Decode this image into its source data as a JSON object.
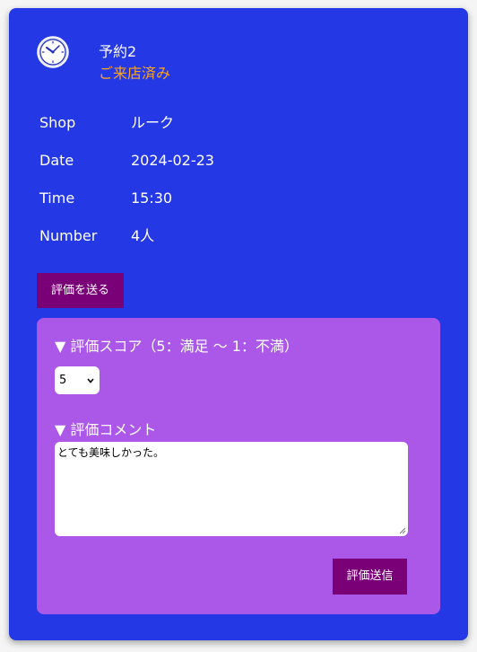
{
  "reservation": {
    "title": "予約2",
    "status": "ご来店済み",
    "status_color": "#ffa51f",
    "icon": "clock-icon"
  },
  "details": [
    {
      "label": "Shop",
      "value": "ルーク"
    },
    {
      "label": "Date",
      "value": "2024-02-23"
    },
    {
      "label": "Time",
      "value": "15:30"
    },
    {
      "label": "Number",
      "value": "4人"
    }
  ],
  "send_review_label": "評価を送る",
  "review": {
    "score_title": "▼ 評価スコア（5：満足 〜 1：不満）",
    "score_selected": "5",
    "comment_title": "▼ 評価コメント",
    "comment_value": "とても美味しかった。",
    "submit_label": "評価送信"
  },
  "colors": {
    "card_bg": "#2438e6",
    "panel_bg": "#ab58e8",
    "button_bg": "#7a0078"
  }
}
